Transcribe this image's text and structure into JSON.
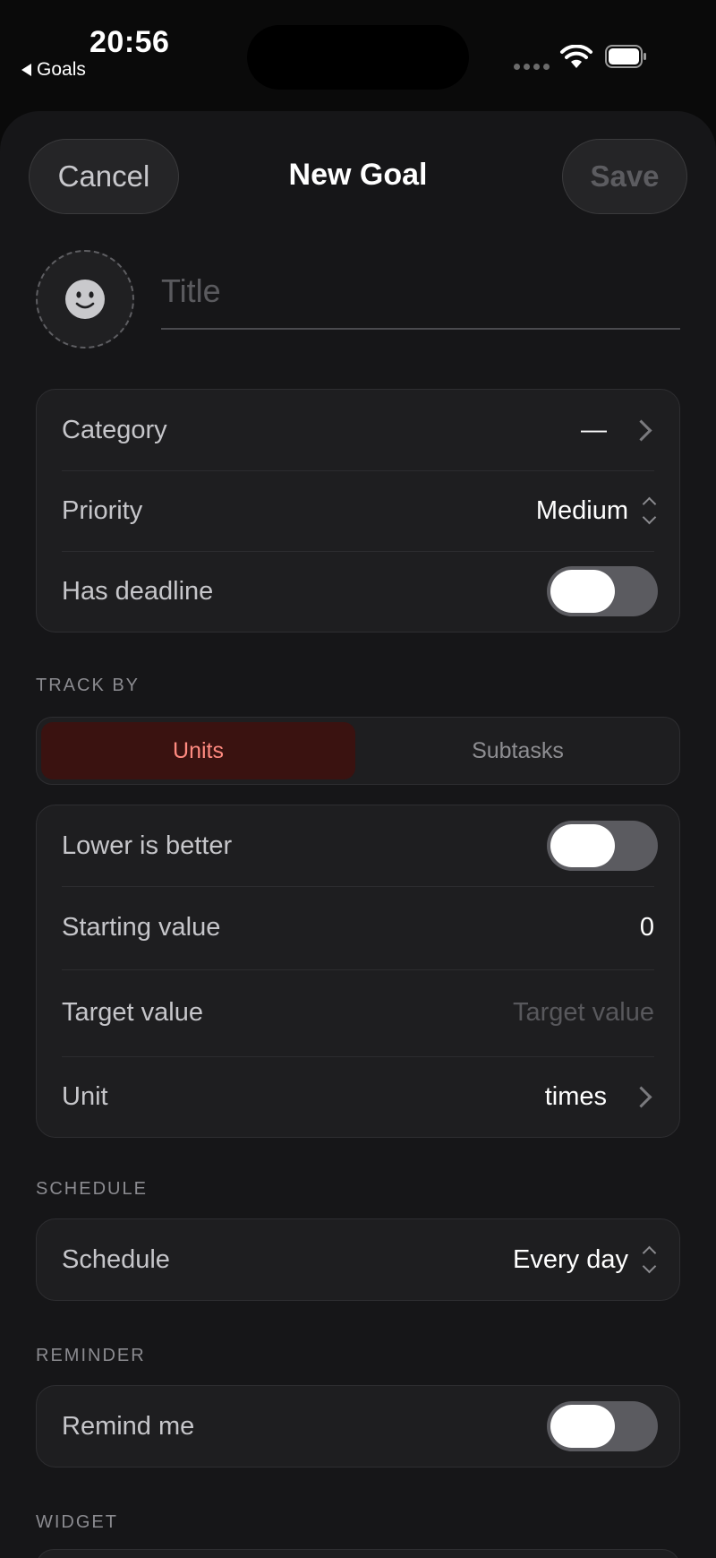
{
  "status_bar": {
    "time": "20:56",
    "back_label": "Goals",
    "icons": [
      "signal-dots-icon",
      "wifi-icon",
      "battery-icon"
    ]
  },
  "nav": {
    "cancel_label": "Cancel",
    "title": "New Goal",
    "save_label": "Save"
  },
  "title_field": {
    "placeholder": "Title",
    "value": "",
    "emoji_icon": "smiley-face-icon"
  },
  "details": {
    "category": {
      "label": "Category",
      "value": "—"
    },
    "priority": {
      "label": "Priority",
      "value": "Medium"
    },
    "has_deadline": {
      "label": "Has deadline",
      "on": false
    }
  },
  "track_by": {
    "header": "TRACK BY",
    "options": [
      "Units",
      "Subtasks"
    ],
    "selected": "Units"
  },
  "units": {
    "lower_is_better": {
      "label": "Lower is better",
      "on": false
    },
    "starting_value": {
      "label": "Starting value",
      "value": "0"
    },
    "target_value": {
      "label": "Target value",
      "placeholder": "Target value"
    },
    "unit": {
      "label": "Unit",
      "value": "times"
    }
  },
  "schedule": {
    "header": "SCHEDULE",
    "label": "Schedule",
    "value": "Every day"
  },
  "reminder": {
    "header": "REMINDER",
    "label": "Remind me",
    "on": false
  },
  "widget": {
    "header": "WIDGET"
  },
  "colors": {
    "background": "#0a0a0a",
    "sheet": "#161618",
    "group": "#1e1e20",
    "accent_bg": "#3a1210",
    "accent_text": "#ff8a80",
    "toggle_off": "#5b5b60"
  }
}
